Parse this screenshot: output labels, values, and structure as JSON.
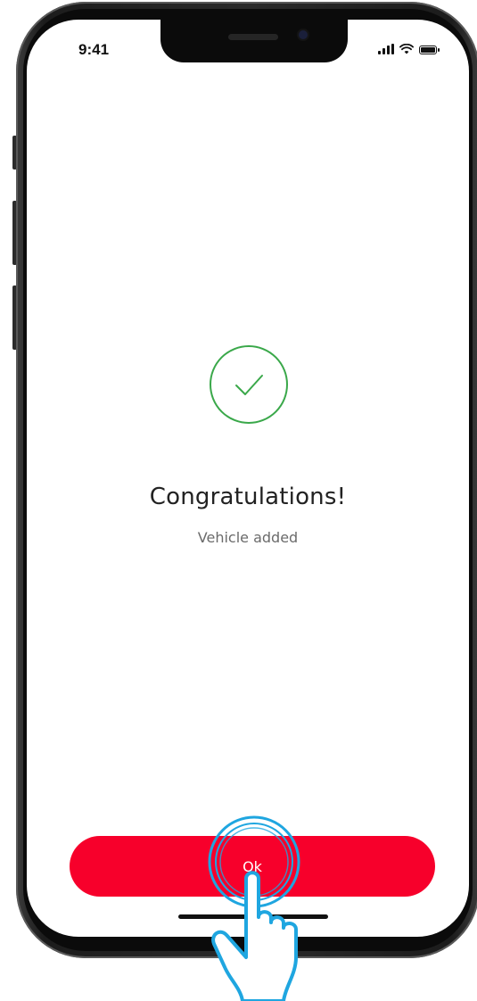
{
  "status_bar": {
    "time": "9:41",
    "icons": [
      "signal-icon",
      "wifi-icon",
      "battery-icon"
    ]
  },
  "success": {
    "icon": "check-circle-icon",
    "title": "Congratulations!",
    "subtitle": "Vehicle added"
  },
  "actions": {
    "ok_label": "Ok"
  },
  "colors": {
    "accent": "#f7002b",
    "success": "#3aa84a",
    "tap_highlight": "#1fa6e0"
  }
}
